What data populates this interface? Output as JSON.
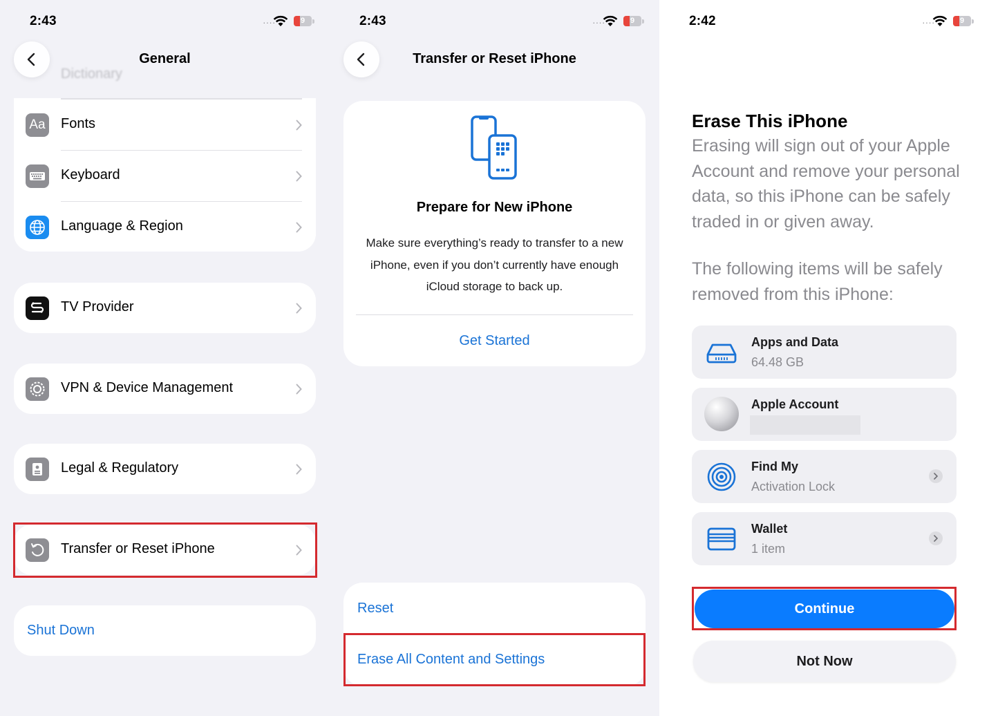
{
  "panel1": {
    "time": "2:43",
    "battery": "9",
    "nav_title": "General",
    "ghost_rows": [
      "Dictionary"
    ],
    "group1": [
      {
        "label": "Fonts",
        "icon": "fonts-icon",
        "glyph": "Aa"
      },
      {
        "label": "Keyboard",
        "icon": "keyboard-icon"
      },
      {
        "label": "Language & Region",
        "icon": "globe-icon"
      }
    ],
    "tv_provider": "TV Provider",
    "vpn": "VPN & Device Management",
    "legal": "Legal & Regulatory",
    "transfer": "Transfer or Reset iPhone",
    "shutdown": "Shut Down"
  },
  "panel2": {
    "time": "2:43",
    "battery": "9",
    "nav_title": "Transfer or Reset iPhone",
    "card_title": "Prepare for New iPhone",
    "card_desc": "Make sure everything’s ready to transfer to a new iPhone, even if you don’t currently have enough iCloud storage to back up.",
    "get_started": "Get Started",
    "reset": "Reset",
    "erase": "Erase All Content and Settings"
  },
  "panel3": {
    "time": "2:42",
    "battery": "9",
    "heading": "Erase This iPhone",
    "para1": "Erasing will sign out of your Apple Account and remove your personal data, so this iPhone can be safely traded in or given away.",
    "para2": "The following items will be safely removed from this iPhone:",
    "items": [
      {
        "title": "Apps and Data",
        "subtitle": "64.48 GB",
        "icon": "drive-icon"
      },
      {
        "title": "Apple Account",
        "subtitle": "",
        "icon": "avatar"
      },
      {
        "title": "Find My",
        "subtitle": "Activation Lock",
        "icon": "find-my-icon"
      },
      {
        "title": "Wallet",
        "subtitle": "1 item",
        "icon": "wallet-icon"
      }
    ],
    "continue": "Continue",
    "not_now": "Not Now"
  },
  "colors": {
    "link_blue": "#1a73d6",
    "button_blue": "#0a7cff",
    "highlight_red": "#d42a2f",
    "grouped_bg": "#f2f2f7"
  }
}
